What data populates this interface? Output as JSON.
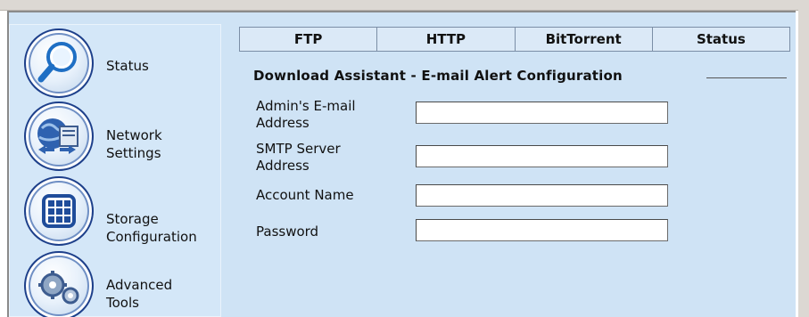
{
  "sidebar": {
    "items": [
      {
        "label": "Status",
        "icon": "magnifier-icon"
      },
      {
        "label": "Network\nSettings",
        "icon": "globe-network-icon"
      },
      {
        "label": "Storage\nConfiguration",
        "icon": "grid-storage-icon"
      },
      {
        "label": "Advanced\nTools",
        "icon": "gears-icon"
      }
    ]
  },
  "tabs": [
    "FTP",
    "HTTP",
    "BitTorrent",
    "Status"
  ],
  "section": {
    "title": "Download Assistant - E-mail Alert Configuration"
  },
  "form": {
    "fields": [
      {
        "label": "Admin's E-mail\nAddress",
        "value": ""
      },
      {
        "label": "SMTP Server\nAddress",
        "value": ""
      },
      {
        "label": "Account Name",
        "value": ""
      },
      {
        "label": "Password",
        "value": ""
      }
    ]
  },
  "colors": {
    "background": "#cfe3f5",
    "sidebar": "#d4e7f8",
    "icon_ring": "#1d3f8a",
    "tab_border": "#7b8ea6"
  }
}
